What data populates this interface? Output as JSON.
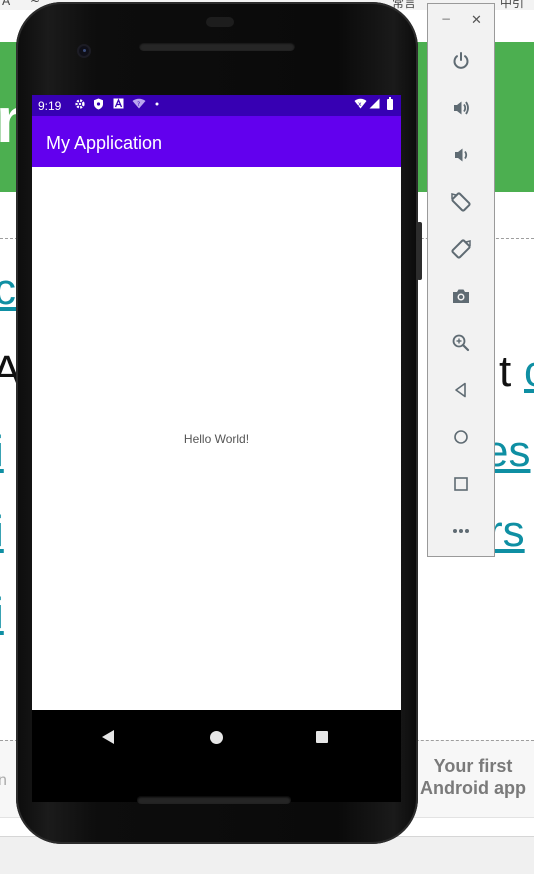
{
  "background_page": {
    "top_strip_text": [
      "A",
      "~",
      "常言",
      "中引"
    ],
    "green_banner_letter": "n",
    "fragments": {
      "row1_left": "c",
      "row2_left": "A",
      "row2_right_black": "t",
      "row2_right_link": "c",
      "row3_left": "i",
      "row3_right": "es",
      "row4_left": "i",
      "row4_right": "rs",
      "row5_left": "i"
    },
    "footer_left_text": "n",
    "footer_card_title": "Your first Android app"
  },
  "emulator": {
    "status_bar": {
      "time": "9:19",
      "icons": [
        "settings-icon",
        "shield-icon",
        "a-icon",
        "wifi-question-icon",
        "dot-icon",
        "wifi-icon",
        "signal-icon",
        "battery-icon"
      ]
    },
    "app": {
      "title": "My Application",
      "body_text": "Hello World!"
    },
    "nav_bar": [
      "back-icon",
      "home-icon",
      "recents-icon"
    ],
    "colors": {
      "status_bar": "#3700b3",
      "app_bar": "#6200ee",
      "page_banner": "#4caf50",
      "link": "#0f8fa3"
    }
  },
  "toolbar": {
    "window_controls": {
      "minimize": "−",
      "close": "✕"
    },
    "buttons": [
      "power",
      "volume-up",
      "volume-down",
      "rotate-left",
      "rotate-right",
      "take-screenshot",
      "zoom",
      "back",
      "home",
      "overview",
      "more"
    ]
  }
}
